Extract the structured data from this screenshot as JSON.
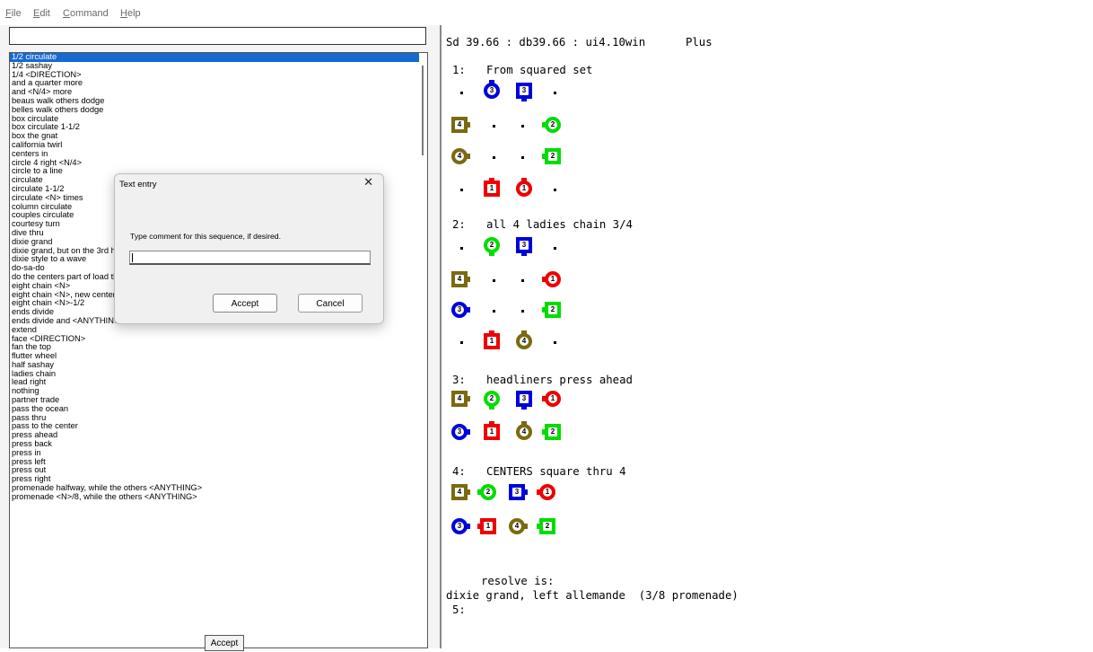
{
  "menu": [
    "File",
    "Edit",
    "Command",
    "Help"
  ],
  "search": {
    "value": ""
  },
  "list": {
    "items": [
      "1/2 circulate",
      "1/2 sashay",
      "1/4 <DIRECTION>",
      "and a quarter more",
      "and <N/4> more",
      "beaus walk others dodge",
      "belles walk others dodge",
      "box circulate",
      "box circulate 1-1/2",
      "box the gnat",
      "california twirl",
      "centers in",
      "circle 4 right <N/4>",
      "circle to a line",
      "circulate",
      "circulate 1-1/2",
      "circulate <N> times",
      "column circulate",
      "couples circulate",
      "courtesy turn",
      "dive thru",
      "dixie grand",
      "dixie grand, but on the 3rd hand",
      "dixie style to a wave",
      "do-sa-do",
      "do the centers part of load the boat",
      "eight chain <N>",
      "eight chain <N>, new centers to a wave",
      "eight chain <N>-1/2",
      "ends divide",
      "ends divide and <ANYTHING>",
      "extend",
      "face <DIRECTION>",
      "fan the top",
      "flutter wheel",
      "half sashay",
      "ladies chain",
      "lead right",
      "nothing",
      "partner trade",
      "pass the ocean",
      "pass thru",
      "pass to the center",
      "press ahead",
      "press back",
      "press in",
      "press left",
      "press out",
      "press right",
      "promenade halfway, while the others <ANYTHING>",
      "promenade <N>/8, while the others <ANYTHING>"
    ],
    "selected_index": 0
  },
  "accept_button": "Accept",
  "output": {
    "header": "Sd 39.66 : db39.66 : ui4.10win",
    "level": "Plus",
    "calls": [
      {
        "num": "1:",
        "text": "From squared set"
      },
      {
        "num": "2:",
        "text": "all 4 ladies chain 3/4"
      },
      {
        "num": "3:",
        "text": "headliners press ahead"
      },
      {
        "num": "4:",
        "text": "CENTERS square thru 4"
      }
    ],
    "resolve_label": "resolve is:",
    "resolve_text": "dixie grand, left allemande  (3/8 promenade)",
    "next_num": "5:"
  },
  "dancers": [
    {
      "label": "3",
      "color": "blue",
      "shape": "circle",
      "facing": "up"
    },
    {
      "label": "3",
      "color": "blue",
      "shape": "square",
      "facing": "down"
    },
    {
      "label": "4",
      "color": "olive",
      "shape": "square",
      "facing": "right"
    },
    {
      "label": "2",
      "color": "green",
      "shape": "circle",
      "facing": "left"
    },
    {
      "label": "4",
      "color": "olive",
      "shape": "circle",
      "facing": "right"
    },
    {
      "label": "2",
      "color": "green",
      "shape": "square",
      "facing": "left"
    },
    {
      "label": "1",
      "color": "red",
      "shape": "square",
      "facing": "up"
    },
    {
      "label": "1",
      "color": "red",
      "shape": "circle",
      "facing": "up"
    },
    {
      "label": "2",
      "color": "green",
      "shape": "circle",
      "facing": "down"
    },
    {
      "label": "3",
      "color": "blue",
      "shape": "square",
      "facing": "down"
    },
    {
      "label": "4",
      "color": "olive",
      "shape": "square",
      "facing": "right"
    },
    {
      "label": "1",
      "color": "red",
      "shape": "circle",
      "facing": "left"
    },
    {
      "label": "3",
      "color": "blue",
      "shape": "circle",
      "facing": "right"
    },
    {
      "label": "2",
      "color": "green",
      "shape": "square",
      "facing": "left"
    },
    {
      "label": "1",
      "color": "red",
      "shape": "square",
      "facing": "up"
    },
    {
      "label": "4",
      "color": "olive",
      "shape": "circle",
      "facing": "up"
    },
    {
      "label": "4",
      "color": "olive",
      "shape": "square",
      "facing": "right"
    },
    {
      "label": "2",
      "color": "green",
      "shape": "circle",
      "facing": "down"
    },
    {
      "label": "3",
      "color": "blue",
      "shape": "square",
      "facing": "down"
    },
    {
      "label": "1",
      "color": "red",
      "shape": "circle",
      "facing": "left"
    },
    {
      "label": "3",
      "color": "blue",
      "shape": "circle",
      "facing": "right"
    },
    {
      "label": "1",
      "color": "red",
      "shape": "square",
      "facing": "up"
    },
    {
      "label": "4",
      "color": "olive",
      "shape": "circle",
      "facing": "up"
    },
    {
      "label": "2",
      "color": "green",
      "shape": "square",
      "facing": "left"
    },
    {
      "label": "4",
      "color": "olive",
      "shape": "square",
      "facing": "right"
    },
    {
      "label": "2",
      "color": "green",
      "shape": "circle",
      "facing": "left"
    },
    {
      "label": "3",
      "color": "blue",
      "shape": "square",
      "facing": "right"
    },
    {
      "label": "1",
      "color": "red",
      "shape": "circle",
      "facing": "left"
    },
    {
      "label": "3",
      "color": "blue",
      "shape": "circle",
      "facing": "right"
    },
    {
      "label": "1",
      "color": "red",
      "shape": "square",
      "facing": "left"
    },
    {
      "label": "4",
      "color": "olive",
      "shape": "circle",
      "facing": "right"
    },
    {
      "label": "2",
      "color": "green",
      "shape": "square",
      "facing": "left"
    }
  ],
  "colors": {
    "red": "#ee0000",
    "green": "#00dd00",
    "blue": "#0000dd",
    "olive": "#7a6a10",
    "selection": "#1569d0"
  },
  "dialog": {
    "title": "Text entry",
    "close": "✕",
    "prompt": "Type comment for this sequence, if desired.",
    "value": "",
    "accept": "Accept",
    "cancel": "Cancel"
  }
}
